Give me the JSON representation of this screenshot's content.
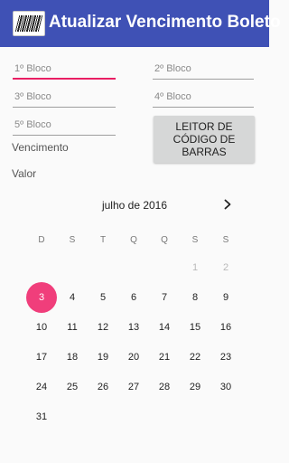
{
  "appbar": {
    "title": "Atualizar Vencimento Boleto"
  },
  "form": {
    "block1_placeholder": "1º Bloco",
    "block2_placeholder": "2º Bloco",
    "block3_placeholder": "3º Bloco",
    "block4_placeholder": "4º Bloco",
    "block5_placeholder": "5º Bloco",
    "reader_button": "LEITOR DE CÓDIGO DE BARRAS",
    "due_label": "Vencimento",
    "value_label": "Valor"
  },
  "calendar": {
    "month_label": "julho de 2016",
    "weekdays": [
      "D",
      "S",
      "T",
      "Q",
      "Q",
      "S",
      "S"
    ],
    "weeks": [
      [
        null,
        null,
        null,
        null,
        null,
        {
          "d": "1",
          "dim": true
        },
        {
          "d": "2",
          "dim": true
        }
      ],
      [
        {
          "d": "3",
          "sel": true
        },
        {
          "d": "4"
        },
        {
          "d": "5"
        },
        {
          "d": "6"
        },
        {
          "d": "7"
        },
        {
          "d": "8"
        },
        {
          "d": "9"
        }
      ],
      [
        {
          "d": "10"
        },
        {
          "d": "11"
        },
        {
          "d": "12"
        },
        {
          "d": "13"
        },
        {
          "d": "14"
        },
        {
          "d": "15"
        },
        {
          "d": "16"
        }
      ],
      [
        {
          "d": "17"
        },
        {
          "d": "18"
        },
        {
          "d": "19"
        },
        {
          "d": "20"
        },
        {
          "d": "21"
        },
        {
          "d": "22"
        },
        {
          "d": "23"
        }
      ],
      [
        {
          "d": "24"
        },
        {
          "d": "25"
        },
        {
          "d": "26"
        },
        {
          "d": "27"
        },
        {
          "d": "28"
        },
        {
          "d": "29"
        },
        {
          "d": "30"
        }
      ],
      [
        {
          "d": "31"
        },
        null,
        null,
        null,
        null,
        null,
        null
      ]
    ],
    "accent_color": "#f03e7b"
  },
  "colors": {
    "appbar": "#3f51b5",
    "focus_underline": "#e91e63"
  }
}
